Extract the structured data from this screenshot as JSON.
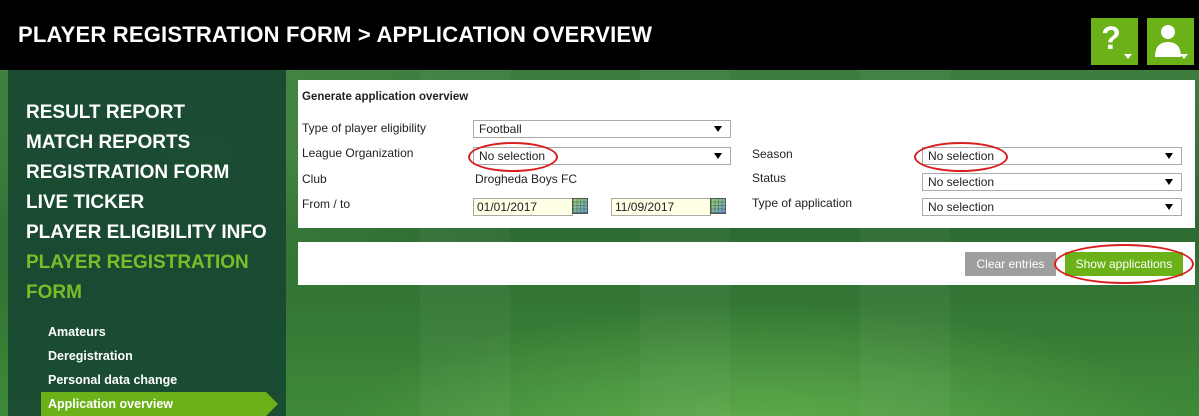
{
  "header": {
    "title": "PLAYER REGISTRATION FORM > APPLICATION OVERVIEW",
    "help_glyph": "?",
    "accent_color": "#6bb218"
  },
  "sidebar": {
    "main_items": [
      {
        "label": "RESULT REPORT"
      },
      {
        "label": "MATCH REPORTS"
      },
      {
        "label": "REGISTRATION FORM"
      },
      {
        "label": "LIVE TICKER"
      },
      {
        "label": "PLAYER ELIGIBILITY INFO"
      },
      {
        "label": "PLAYER REGISTRATION FORM"
      }
    ],
    "sub_items": [
      {
        "label": "Amateurs"
      },
      {
        "label": "Deregistration"
      },
      {
        "label": "Personal data change"
      },
      {
        "label": "Application overview"
      }
    ]
  },
  "form": {
    "title": "Generate application overview",
    "eligibility_label": "Type of player eligibility",
    "eligibility_value": "Football",
    "league_label": "League Organization",
    "league_value": "No selection",
    "club_label": "Club",
    "club_value": "Drogheda Boys FC",
    "fromto_label": "From / to",
    "from_date": "01/01/2017",
    "to_date": "11/09/2017",
    "season_label": "Season",
    "season_value": "No selection",
    "status_label": "Status",
    "status_value": "No selection",
    "apptype_label": "Type of application",
    "apptype_value": "No selection"
  },
  "actions": {
    "clear_label": "Clear entries",
    "show_label": "Show applications"
  }
}
